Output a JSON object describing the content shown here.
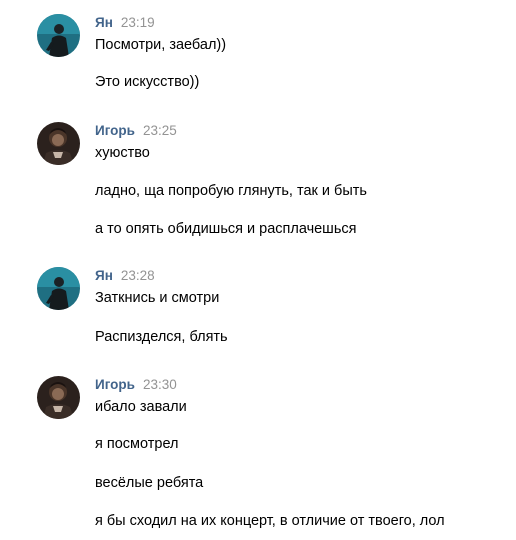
{
  "messages": [
    {
      "author": "Ян",
      "time": "23:19",
      "avatar_icon": "user-avatar-yan",
      "lines": [
        "Посмотри, заебал))",
        "Это искусство))"
      ]
    },
    {
      "author": "Игорь",
      "time": "23:25",
      "avatar_icon": "user-avatar-igor",
      "lines": [
        "хуюство",
        "ладно, ща попробую глянуть, так и быть",
        "а то опять обидишься и расплачешься"
      ]
    },
    {
      "author": "Ян",
      "time": "23:28",
      "avatar_icon": "user-avatar-yan",
      "lines": [
        "Заткнись и смотри",
        "Распизделся, блять"
      ]
    },
    {
      "author": "Игорь",
      "time": "23:30",
      "avatar_icon": "user-avatar-igor",
      "lines": [
        "ибало завали",
        "я посмотрел",
        "весёлые ребята",
        "я бы сходил на их концерт, в отличие от твоего, лол"
      ]
    }
  ],
  "colors": {
    "author_name": "#42648b",
    "timestamp": "#939393",
    "message_text": "#000000"
  }
}
